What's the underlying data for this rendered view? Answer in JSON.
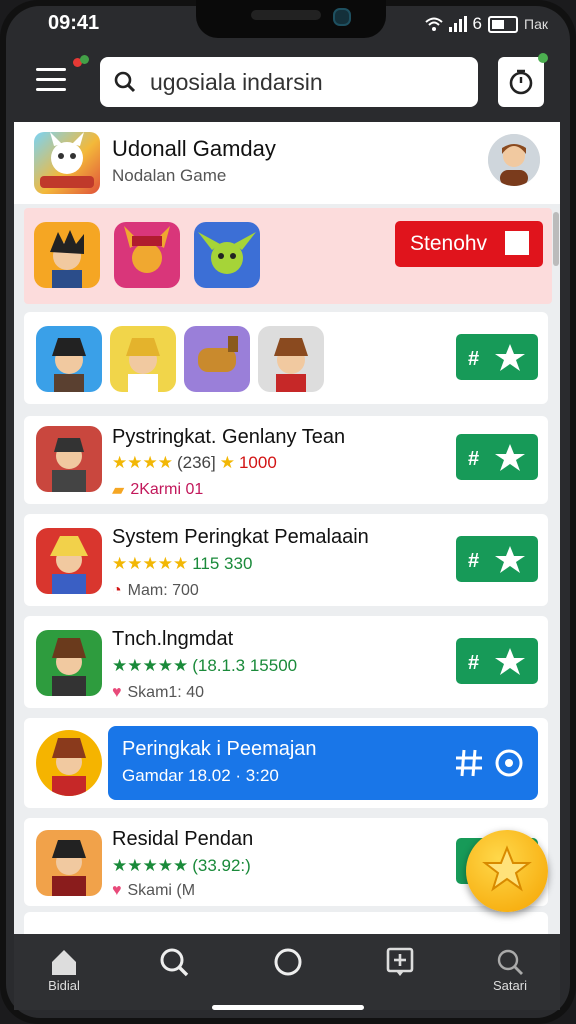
{
  "status_bar": {
    "time": "09:41",
    "signal": "6",
    "network": "Пак"
  },
  "search": {
    "value": "ugosiala indarsin",
    "placeholder": ""
  },
  "header": {
    "title": "Udonall Gamday",
    "subtitle": "Nodalan Game"
  },
  "promo": {
    "button_label": "Stenohv"
  },
  "games": [
    {
      "title": "Pystringkat. Genlany Tean",
      "rating_text": "(236]",
      "coin_text": "1000",
      "meta": "2Karmi 01"
    },
    {
      "title": "System Peringkat Pemalaain",
      "rating_text": "115 330",
      "meta": "Mam: 700"
    },
    {
      "title": "Tnch.lngmdat",
      "rating_text": "(18.1.3 15500",
      "meta": "Skam1: 40"
    },
    {
      "title": "Residal Pendan",
      "rating_text": "(33.92:)",
      "meta": "Skami (M"
    }
  ],
  "highlight": {
    "title": "Peringkak i Peemajan",
    "subtitle": "Gamdar 18.02 · 3:20"
  },
  "nav": [
    {
      "label": "Bidial",
      "icon": "home-icon"
    },
    {
      "label": "",
      "icon": "search-icon"
    },
    {
      "label": "",
      "icon": "circle-icon"
    },
    {
      "label": "",
      "icon": "add-box-icon"
    },
    {
      "label": "Satari",
      "icon": "search-icon"
    }
  ],
  "colors": {
    "accent_green": "#179a58",
    "accent_red": "#e0141c",
    "accent_blue": "#1976e8",
    "promo_band": "#fcdcdc"
  }
}
